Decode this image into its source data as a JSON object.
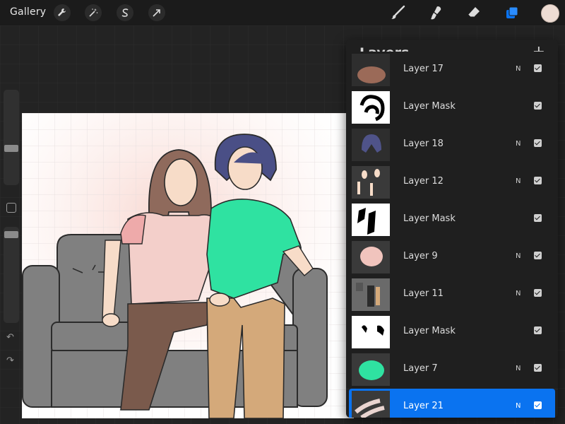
{
  "toolbar": {
    "gallery_label": "Gallery",
    "left_tools": [
      "wrench-icon",
      "magic-wand-icon",
      "selection-s-icon",
      "transform-arrow-icon"
    ],
    "right_tools": [
      "brush-icon",
      "smudge-icon",
      "eraser-icon",
      "layers-icon"
    ],
    "active_color": "#eddcd3",
    "accent_color": "#0a73f0"
  },
  "layers_panel": {
    "title": "Layers",
    "add_icon": "+",
    "layers": [
      {
        "name": "Layer 17",
        "blend": "N",
        "visible": true
      },
      {
        "name": "Layer Mask",
        "blend": "",
        "visible": true
      },
      {
        "name": "Layer 18",
        "blend": "N",
        "visible": true
      },
      {
        "name": "Layer 12",
        "blend": "N",
        "visible": true
      },
      {
        "name": "Layer Mask",
        "blend": "",
        "visible": true
      },
      {
        "name": "Layer 9",
        "blend": "N",
        "visible": true
      },
      {
        "name": "Layer 11",
        "blend": "N",
        "visible": true
      },
      {
        "name": "Layer Mask",
        "blend": "",
        "visible": true
      },
      {
        "name": "Layer 7",
        "blend": "N",
        "visible": true
      },
      {
        "name": "Layer 21",
        "blend": "N",
        "visible": true,
        "selected": true
      }
    ]
  },
  "sidebar": {
    "undo_icon": "↶",
    "redo_icon": "↷"
  }
}
